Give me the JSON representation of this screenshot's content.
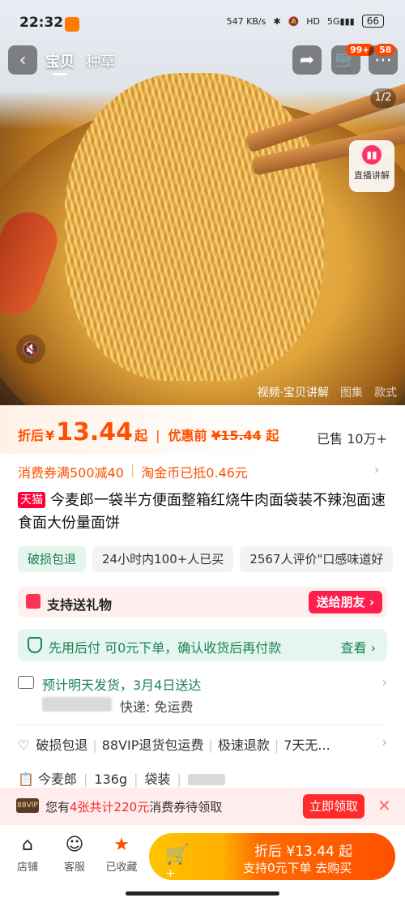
{
  "status_bar": {
    "time": "22:32",
    "net_speed": "547 KB/s",
    "battery": "66"
  },
  "top_nav": {
    "tabs": [
      {
        "label": "宝贝",
        "active": true
      },
      {
        "label": "种草",
        "active": false
      }
    ],
    "cart_badge": "99+",
    "more_badge": "58"
  },
  "media": {
    "pager": "1/2",
    "live_label": "直播讲解",
    "tabs": [
      "视频·宝贝讲解",
      "图集",
      "款式"
    ]
  },
  "price": {
    "label": "折后",
    "currency": "¥",
    "value": "13.44",
    "suffix": "起",
    "discount_label": "优惠前",
    "original": "¥15.44",
    "original_suffix": "起",
    "sold": "已售 10万+"
  },
  "coupon_line": {
    "left": "消费券满500减40",
    "right": "淘金币已抵0.46元"
  },
  "product": {
    "store_tag": "天猫",
    "title": "今麦郎一袋半方便面整箱红烧牛肉面袋装不辣泡面速食面大份量面饼"
  },
  "tags": [
    "破损包退",
    "24小时内100+人已买",
    "2567人评价\"口感味道好"
  ],
  "gift": {
    "label": "支持送礼物",
    "button": "送给朋友 ›"
  },
  "pay_later": {
    "text": "先用后付 可0元下单，确认收货后再付款",
    "link": "查看 ›"
  },
  "shipping": {
    "line1": "预计明天发货，3月4日送达",
    "line2": "快递: 免运费"
  },
  "service": {
    "items": [
      "破损包退",
      "88VIP退货包运费",
      "极速退款",
      "7天无..."
    ]
  },
  "spec": {
    "brand": "今麦郎",
    "weight": "136g",
    "pack": "袋装"
  },
  "coupon_banner": {
    "vip": "88VIP",
    "text_pre": "您有",
    "text_hl": "4张共计220元",
    "text_post": "消费券待领取",
    "claim": "立即领取"
  },
  "bottom_bar": {
    "shop": "店铺",
    "service": "客服",
    "fav": "已收藏",
    "cta_line1": "折后 ¥13.44 起",
    "cta_line2": "支持0元下单 去购买"
  },
  "colors": {
    "accent": "#ff5000",
    "tmall": "#ff0036",
    "green": "#1c8356"
  }
}
